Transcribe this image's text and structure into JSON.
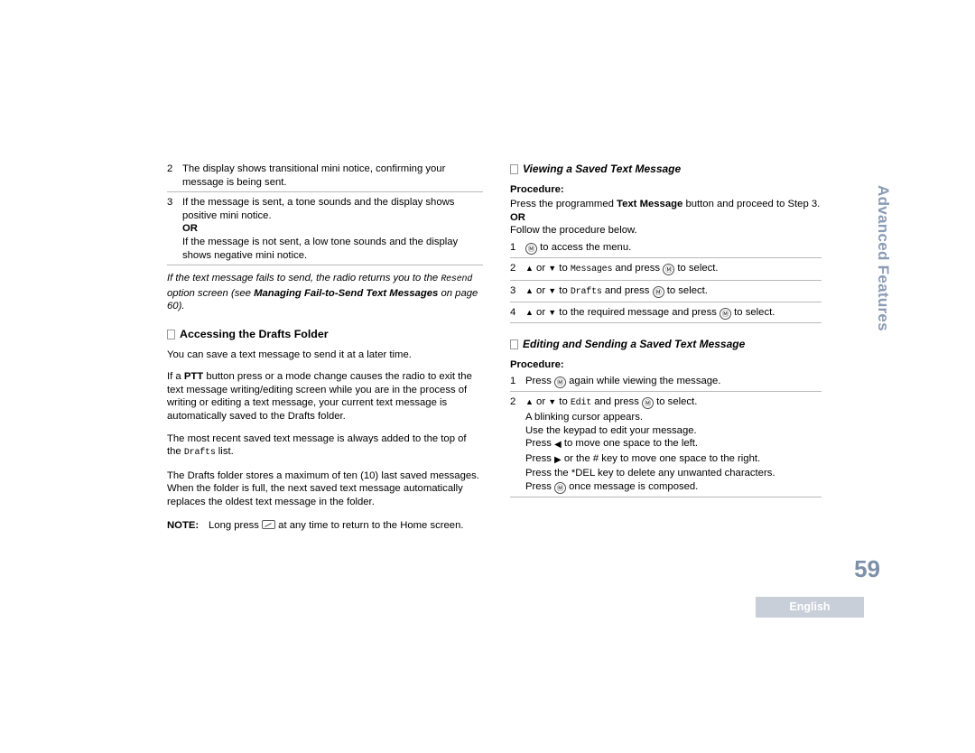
{
  "left_column": {
    "steps_top": [
      {
        "num": "2",
        "text": "The display shows transitional mini notice, confirming your message is being sent."
      },
      {
        "num": "3",
        "text": "If the message is sent, a tone sounds and the display shows positive mini notice.",
        "or": "OR",
        "text2": "If the message is not sent, a low tone sounds and the display shows negative mini notice."
      }
    ],
    "italic_note": {
      "part1": "If the text message fails to send, the radio returns you to the ",
      "resend": "Resend",
      "part2": " option screen (see ",
      "bold_ref": "Managing Fail-to-Send Text Messages",
      "part3": " on page 60)."
    },
    "heading": "Accessing the Drafts Folder",
    "para1": "You can save a text message to send it at a later time.",
    "para2_a": "If a ",
    "para2_ptt": "PTT",
    "para2_b": " button press or a mode change causes the radio to exit the text message writing/editing screen while you are in the process of writing or editing a text message, your current text message is automatically saved to the Drafts folder.",
    "para3_a": "The most recent saved text message is always added to the top of the ",
    "para3_drafts": "Drafts",
    "para3_b": " list.",
    "para4_a": "The Drafts folder stores a maximum of ten (10) last saved messages. When the folder is full, the next saved text message automatically replaces the oldest text message in the folder.",
    "note_label": "NOTE:",
    "note_text_a": "Long press ",
    "note_text_b": " at any time to return to the Home screen."
  },
  "right_column": {
    "section1": {
      "heading": "Viewing a Saved Text Message",
      "procedure_label": "Procedure:",
      "intro_a": "Press the programmed ",
      "intro_bold": "Text Message",
      "intro_b": " button and proceed to Step 3.",
      "or": "OR",
      "follow": "Follow the procedure below.",
      "steps": [
        {
          "num": "1",
          "pre": "",
          "key": "MENU",
          "post": " to access the menu."
        },
        {
          "num": "2",
          "pre": "",
          "up": "▲",
          "or": " or ",
          "down": "▼",
          "mid": " to ",
          "mono": "Messages",
          "mid2": " and press ",
          "key": "MENU",
          "post": " to select."
        },
        {
          "num": "3",
          "pre": "",
          "up": "▲",
          "or": " or ",
          "down": "▼",
          "mid": " to ",
          "mono": "Drafts",
          "mid2": " and press ",
          "key": "MENU",
          "post": " to select."
        },
        {
          "num": "4",
          "pre": "",
          "up": "▲",
          "or": " or ",
          "down": "▼",
          "mid": " to the required message and press ",
          "key": "MENU",
          "post": " to select."
        }
      ]
    },
    "section2": {
      "heading": "Editing and Sending a Saved Text Message",
      "procedure_label": "Procedure:",
      "step1": {
        "num": "1",
        "pre": "Press ",
        "key": "MENU",
        "post": " again while viewing the message."
      },
      "step2": {
        "num": "2",
        "up": "▲",
        "or": " or ",
        "down": "▼",
        "mid": " to ",
        "mono": "Edit",
        "mid2": " and press ",
        "key": "MENU",
        "post": " to select.",
        "lines": [
          "A blinking cursor appears.",
          "Use the keypad to edit your message.",
          "Press ◀ to move one space to the left.",
          "Press ▶ or the # key to move one space to the right.",
          "Press the *DEL key to delete any unwanted characters.",
          "Press Ⓜ once message is composed."
        ],
        "line_left_a": "Press ",
        "line_left_b": " to move one space to the left.",
        "line_right_a": "Press ",
        "line_right_b": " or the # key to move one space to the right.",
        "line_del": "Press the *DEL key to delete any unwanted characters.",
        "line_done_a": "Press ",
        "line_done_b": " once message is composed.",
        "line_cursor": "A blinking cursor appears.",
        "line_keypad": "Use the keypad to edit your message."
      }
    }
  },
  "side_tab": "Advanced Features",
  "page_number": "59",
  "language_badge": "English",
  "colors": {
    "accent": "#7e8fa8",
    "badge_bg": "#c8cfd9",
    "rule": "#b9b9b9"
  }
}
